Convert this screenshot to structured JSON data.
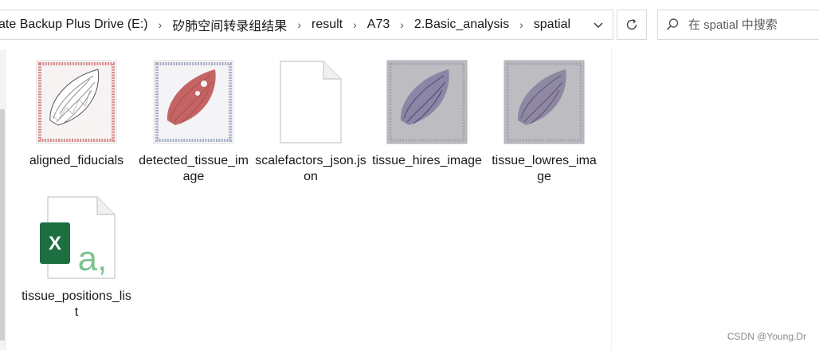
{
  "breadcrumb": {
    "items": [
      "ate Backup Plus Drive (E:)",
      "矽肺空间转录组结果",
      "result",
      "A73",
      "2.Basic_analysis",
      "spatial"
    ],
    "separator": "›"
  },
  "search": {
    "placeholder": "在 spatial 中搜索"
  },
  "files": [
    {
      "name": "aligned_fiducials",
      "type": "image",
      "icon": "tissue-image-thumbnail"
    },
    {
      "name": "detected_tissue_image",
      "type": "image",
      "icon": "tissue-image-thumbnail"
    },
    {
      "name": "scalefactors_json.json",
      "type": "json",
      "icon": "blank-document-icon"
    },
    {
      "name": "tissue_hires_image",
      "type": "image",
      "icon": "tissue-image-thumbnail"
    },
    {
      "name": "tissue_lowres_image",
      "type": "image",
      "icon": "tissue-image-thumbnail"
    },
    {
      "name": "tissue_positions_list",
      "type": "csv",
      "icon": "excel-csv-icon"
    }
  ],
  "watermark": "CSDN @Young.Dr",
  "colors": {
    "border": "#d9d9d9",
    "excel_green": "#1d6f42",
    "csv_letter": "#7cc48f"
  }
}
